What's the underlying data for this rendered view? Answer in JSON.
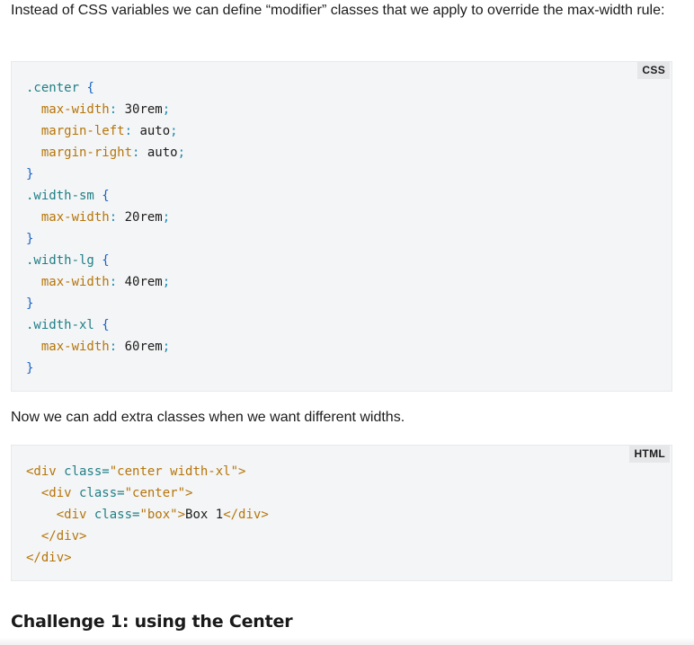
{
  "intro_paragraph": "Instead of CSS variables we can define “modifier” classes that we apply to override the max-width rule:",
  "css_block": {
    "language": "CSS",
    "lines": [
      [
        {
          "t": ".center",
          "c": "sel"
        },
        {
          "t": " ",
          "c": "val"
        },
        {
          "t": "{",
          "c": "brace"
        }
      ],
      [
        {
          "t": "  max-width",
          "c": "prop"
        },
        {
          "t": ":",
          "c": "punct"
        },
        {
          "t": " 30rem",
          "c": "val"
        },
        {
          "t": ";",
          "c": "punct"
        }
      ],
      [
        {
          "t": "  margin-left",
          "c": "prop"
        },
        {
          "t": ":",
          "c": "punct"
        },
        {
          "t": " auto",
          "c": "val"
        },
        {
          "t": ";",
          "c": "punct"
        }
      ],
      [
        {
          "t": "  margin-right",
          "c": "prop"
        },
        {
          "t": ":",
          "c": "punct"
        },
        {
          "t": " auto",
          "c": "val"
        },
        {
          "t": ";",
          "c": "punct"
        }
      ],
      [
        {
          "t": "}",
          "c": "brace"
        }
      ],
      [
        {
          "t": ".width-sm",
          "c": "sel"
        },
        {
          "t": " ",
          "c": "val"
        },
        {
          "t": "{",
          "c": "brace"
        }
      ],
      [
        {
          "t": "  max-width",
          "c": "prop"
        },
        {
          "t": ":",
          "c": "punct"
        },
        {
          "t": " 20rem",
          "c": "val"
        },
        {
          "t": ";",
          "c": "punct"
        }
      ],
      [
        {
          "t": "}",
          "c": "brace"
        }
      ],
      [
        {
          "t": ".width-lg",
          "c": "sel"
        },
        {
          "t": " ",
          "c": "val"
        },
        {
          "t": "{",
          "c": "brace"
        }
      ],
      [
        {
          "t": "  max-width",
          "c": "prop"
        },
        {
          "t": ":",
          "c": "punct"
        },
        {
          "t": " 40rem",
          "c": "val"
        },
        {
          "t": ";",
          "c": "punct"
        }
      ],
      [
        {
          "t": "}",
          "c": "brace"
        }
      ],
      [
        {
          "t": ".width-xl",
          "c": "sel"
        },
        {
          "t": " ",
          "c": "val"
        },
        {
          "t": "{",
          "c": "brace"
        }
      ],
      [
        {
          "t": "  max-width",
          "c": "prop"
        },
        {
          "t": ":",
          "c": "punct"
        },
        {
          "t": " 60rem",
          "c": "val"
        },
        {
          "t": ";",
          "c": "punct"
        }
      ],
      [
        {
          "t": "}",
          "c": "brace"
        }
      ]
    ]
  },
  "middle_paragraph": "Now we can add extra classes when we want different widths.",
  "html_block": {
    "language": "HTML",
    "lines": [
      [
        {
          "t": "<div",
          "c": "tag"
        },
        {
          "t": " class",
          "c": "attr"
        },
        {
          "t": "=",
          "c": "attr"
        },
        {
          "t": "\"center width-xl\"",
          "c": "str"
        },
        {
          "t": ">",
          "c": "tag"
        }
      ],
      [
        {
          "t": "  <div",
          "c": "tag"
        },
        {
          "t": " class",
          "c": "attr"
        },
        {
          "t": "=",
          "c": "attr"
        },
        {
          "t": "\"center\"",
          "c": "str"
        },
        {
          "t": ">",
          "c": "tag"
        }
      ],
      [
        {
          "t": "    <div",
          "c": "tag"
        },
        {
          "t": " class",
          "c": "attr"
        },
        {
          "t": "=",
          "c": "attr"
        },
        {
          "t": "\"box\"",
          "c": "str"
        },
        {
          "t": ">",
          "c": "tag"
        },
        {
          "t": "Box 1",
          "c": "text"
        },
        {
          "t": "</div>",
          "c": "tag"
        }
      ],
      [
        {
          "t": "  </div>",
          "c": "tag"
        }
      ],
      [
        {
          "t": "</div>",
          "c": "tag"
        }
      ]
    ]
  },
  "section_heading": "Challenge 1: using the Center",
  "colors": {
    "selector": "#1f7f86",
    "brace": "#1a63c4",
    "property": "#b5750a",
    "punctuation": "#1a8bb0",
    "code_background": "#f4f5f6"
  }
}
